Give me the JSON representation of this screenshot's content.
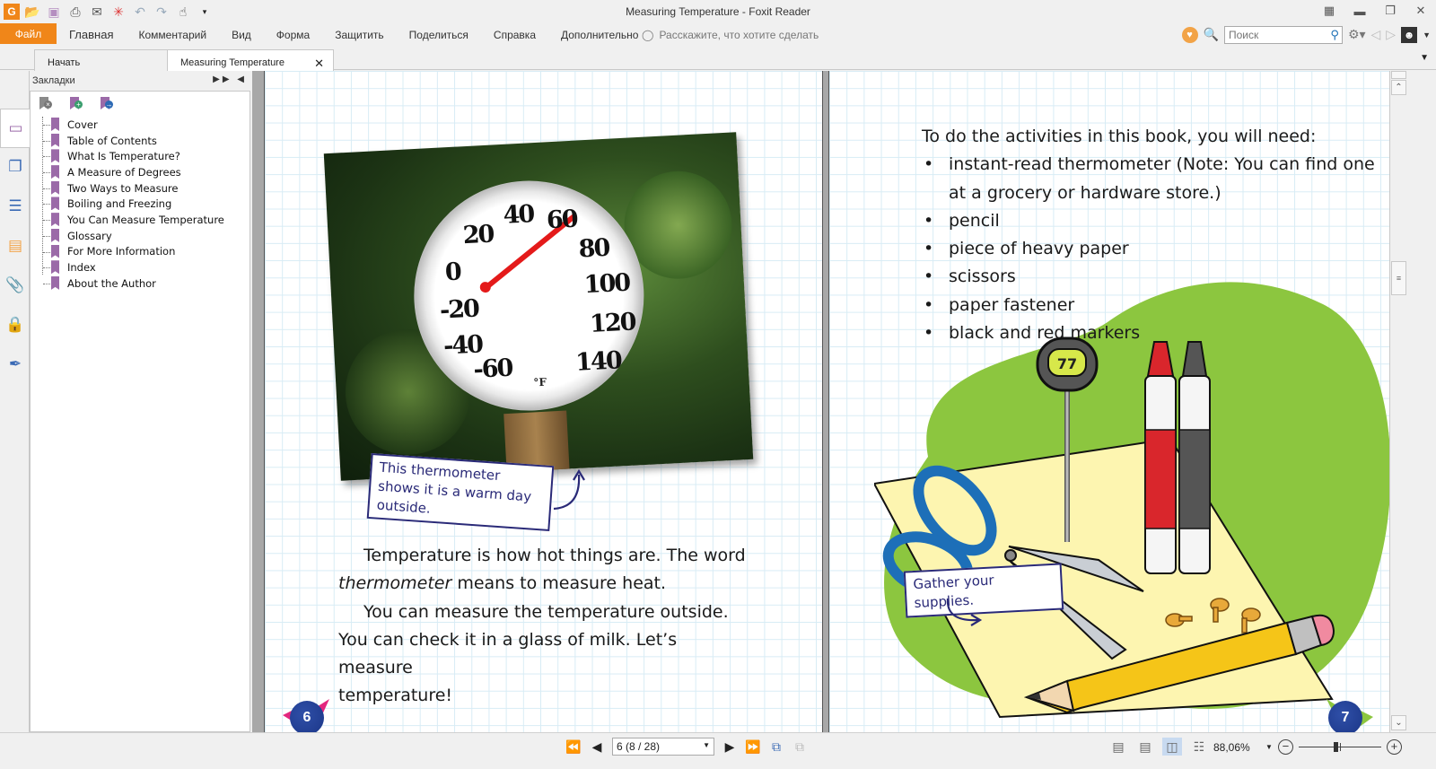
{
  "window": {
    "title": "Measuring Temperature - Foxit Reader",
    "controls": [
      "fullscreen-icon",
      "minimize-icon",
      "restore-icon",
      "close-icon"
    ]
  },
  "quick_access": [
    "app-logo-icon",
    "open-folder-icon",
    "save-icon",
    "print-icon",
    "email-icon",
    "new-document-icon",
    "undo-icon",
    "redo-icon",
    "hand-tool-icon",
    "customize-dropdown-icon"
  ],
  "menu": {
    "file": "Файл",
    "items": [
      "Главная",
      "Комментарий",
      "Вид",
      "Форма",
      "Защитить",
      "Поделиться",
      "Справка",
      "Дополнительно"
    ],
    "tell_me_placeholder": "Расскажите, что хотите сделать"
  },
  "toolbar_right": {
    "search_placeholder": "Поиск"
  },
  "tabs": [
    {
      "label": "Начать",
      "active": false
    },
    {
      "label": "Measuring Temperature",
      "active": true
    }
  ],
  "bookmarks": {
    "title": "Закладки",
    "tools": [
      "delete-bookmark-icon",
      "add-bookmark-icon",
      "go-to-bookmark-icon"
    ],
    "items": [
      "Cover",
      "Table of Contents",
      "What Is Temperature?",
      "A Measure of Degrees",
      "Two Ways to Measure",
      "Boiling and Freezing",
      "You Can Measure Temperature",
      "Glossary",
      "For More Information",
      "Index",
      "About the Author"
    ]
  },
  "left_strip": [
    "bookmark-panel-icon",
    "pages-icon",
    "layers-icon",
    "comments-icon",
    "attachments-icon",
    "security-icon",
    "signatures-icon"
  ],
  "page_left": {
    "dial_numbers": [
      "20",
      "40",
      "60",
      "80",
      "0",
      "100",
      "-20",
      "120",
      "-40",
      "140",
      "-60"
    ],
    "dial_unit": "°F",
    "caption": "This thermometer shows it is a warm day outside.",
    "para1_a": "Temperature is how hot things are. The word",
    "para1_em": "thermometer",
    "para1_b": " means to measure heat.",
    "para2_a": "You can measure the temperature outside.",
    "para2_b": "You can check it in a glass of milk. Let’s measure",
    "para2_c": "temperature!",
    "page_number": "6"
  },
  "page_right": {
    "intro": "To do the activities in this book, you will need:",
    "items": [
      "instant-read thermometer (Note: You can find one at a grocery or hardware store.)",
      "pencil",
      "piece of heavy paper",
      "scissors",
      "paper fastener",
      "black and red markers"
    ],
    "thermometer_display": "77",
    "caption": "Gather your supplies.",
    "page_number": "7"
  },
  "status": {
    "page_field": "6 (8 / 28)",
    "zoom": "88,06%",
    "zoom_slider_fraction": 0.45,
    "view_modes": [
      "single-page",
      "continuous",
      "facing",
      "continuous-facing"
    ],
    "active_view_mode": "facing"
  },
  "colors": {
    "accent": "#f08619",
    "bookmark": "#9b6aa8",
    "caption_ink": "#2a2a78",
    "page_badge": "#1b3687",
    "grid": "#d8ecf5"
  }
}
